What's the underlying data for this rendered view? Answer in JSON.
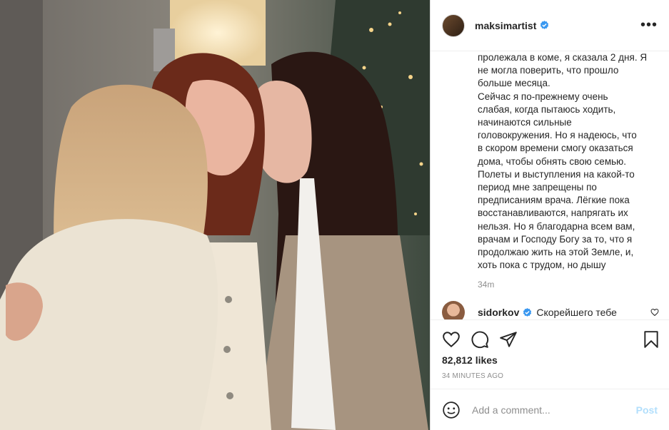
{
  "post": {
    "username": "maksimartist",
    "caption": "пролежала в коме, я сказала 2 дня. Я\nне могла поверить, что прошло\nбольше месяца.\nСейчас я по-прежнему очень\nслабая, когда пытаюсь ходить,\nначинаются сильные\nголовокружения. Но я надеюсь, что\nв скором времени смогу оказаться\nдома, чтобы обнять свою семью.\nПолеты и выступления на какой-то\nпериод мне запрещены по\nпредписаниям врача. Лёгкие пока\nвосстанавливаются, напрягать их\nнельзя. Но я благодарна всем вам,\nврачам и Господу Богу за то, что я\nпродолжаю жить на этой Земле, и,\nхоть пока с трудом, но дышу",
    "caption_time": "34m",
    "likes": "82,812 likes",
    "posted_ago": "34 MINUTES AGO"
  },
  "comment": {
    "username": "sidorkov",
    "text": "Скорейшего тебе"
  },
  "add_comment": {
    "placeholder": "Add a comment...",
    "post_label": "Post"
  },
  "icons": {
    "more": "more-options-icon",
    "verified": "verified-badge-icon",
    "like": "heart-icon",
    "comment": "comment-icon",
    "share": "share-icon",
    "save": "bookmark-icon",
    "emoji": "emoji-icon"
  },
  "colors": {
    "verified": "#3897f0",
    "post_disabled": "#b2dffc"
  },
  "more_label": "•••"
}
